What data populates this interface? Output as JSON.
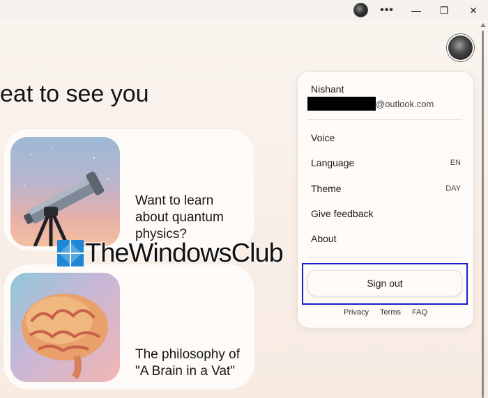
{
  "titlebar": {
    "more_label": "•••",
    "minimize_label": "—",
    "maximize_label": "❐",
    "close_label": "✕"
  },
  "main": {
    "greeting": "eat to see you",
    "cards": [
      {
        "text": "Want to learn about quantum physics?",
        "image": "telescope"
      },
      {
        "text": "The philosophy of \"A Brain in a Vat\"",
        "image": "brain"
      }
    ]
  },
  "watermark": {
    "text": "TheWindowsClub"
  },
  "account_menu": {
    "user_name": "Nishant",
    "email_domain": "@outlook.com",
    "items": [
      {
        "label": "Voice",
        "value": ""
      },
      {
        "label": "Language",
        "value": "EN"
      },
      {
        "label": "Theme",
        "value": "DAY"
      },
      {
        "label": "Give feedback",
        "value": ""
      },
      {
        "label": "About",
        "value": ""
      }
    ],
    "sign_out_label": "Sign out",
    "footer_links": [
      "Privacy",
      "Terms",
      "FAQ"
    ]
  },
  "colors": {
    "highlight": "#1520c8",
    "background": "#f8eee6"
  }
}
